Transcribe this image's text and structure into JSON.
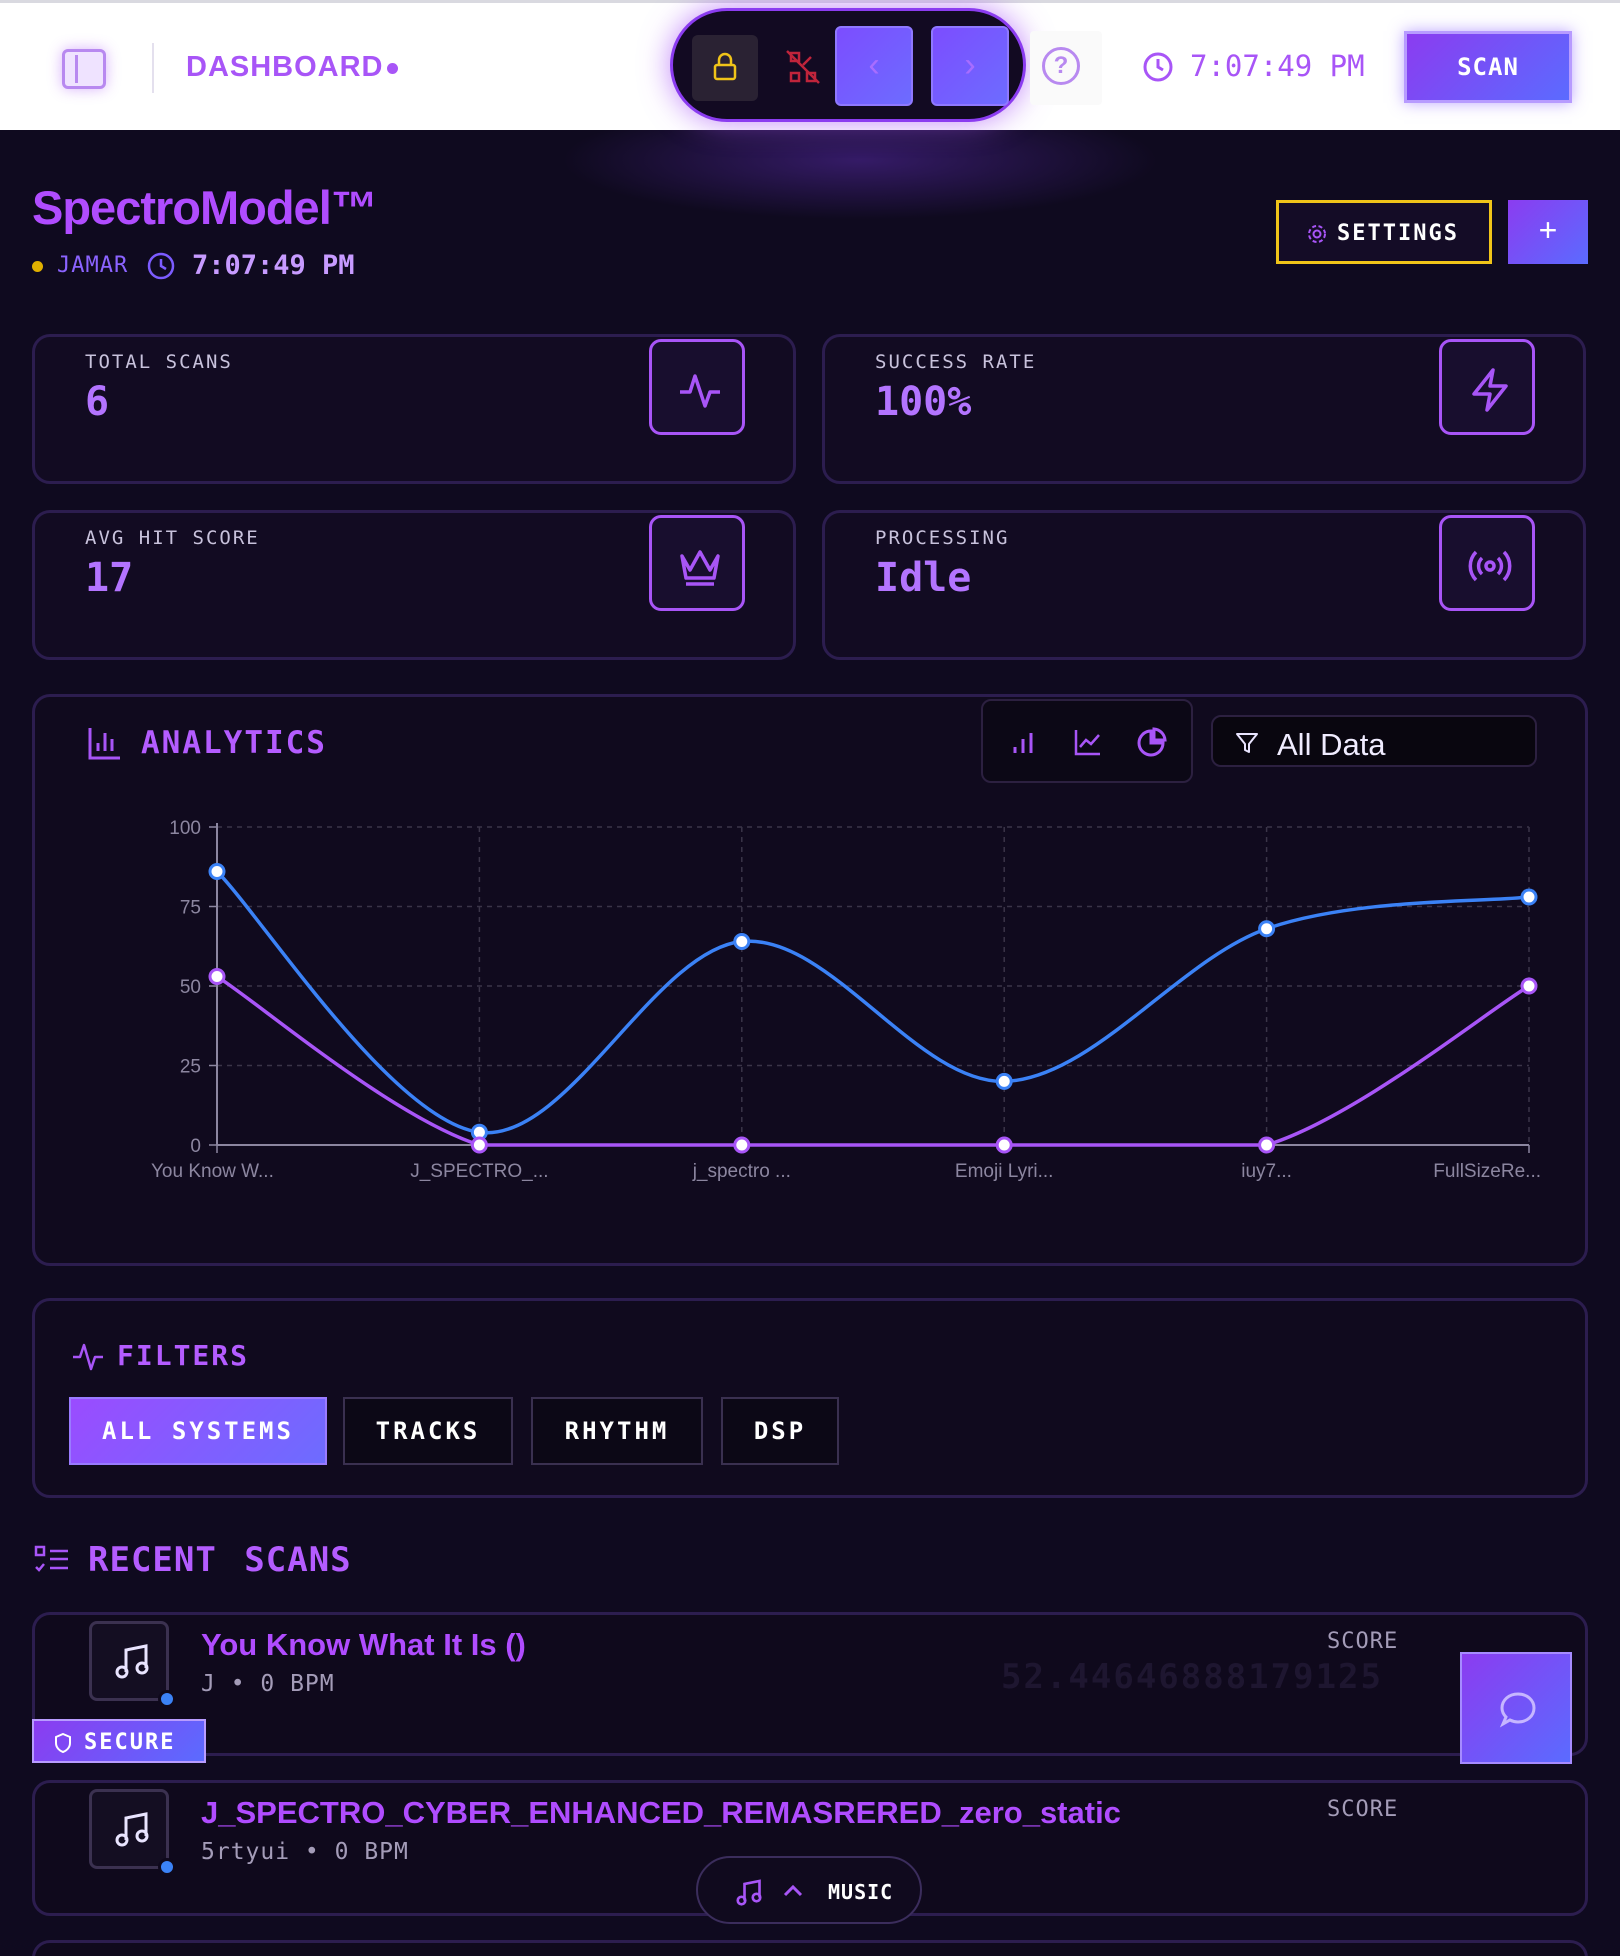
{
  "topbar": {
    "dashboard_label": "DASHBOARD",
    "time": "7:07:49 PM",
    "scan_label": "SCAN",
    "prev_glyph": "‹",
    "next_glyph": "›",
    "help_glyph": "?"
  },
  "header": {
    "app_title": "SpectroModel™",
    "user": "JAMAR",
    "time": "7:07:49 PM",
    "settings_label": "SETTINGS",
    "add_label": "+"
  },
  "stats": [
    {
      "label": "TOTAL SCANS",
      "value": "6",
      "icon": "activity-icon"
    },
    {
      "label": "SUCCESS RATE",
      "value": "100%",
      "icon": "zap-icon"
    },
    {
      "label": "AVG HIT SCORE",
      "value": "17",
      "icon": "crown-icon"
    },
    {
      "label": "PROCESSING",
      "value": "Idle",
      "icon": "radio-icon"
    }
  ],
  "analytics": {
    "title": "ANALYTICS",
    "filter_value": "All Data"
  },
  "chart_data": {
    "type": "line",
    "categories": [
      "You Know W...",
      "J_SPECTRO_...",
      "j_spectro ...",
      "Emoji Lyri...",
      "iuy7...",
      "FullSizeRe..."
    ],
    "series": [
      {
        "values": [
          86,
          4,
          64,
          20,
          68,
          78
        ],
        "color": "#3b82f6"
      },
      {
        "values": [
          53,
          0,
          0,
          0,
          0,
          50
        ],
        "color": "#a855f7"
      }
    ],
    "ylim": [
      0,
      100
    ],
    "yticks": [
      "0",
      "25",
      "50",
      "75",
      "100"
    ],
    "grid": true
  },
  "filters": {
    "title": "FILTERS",
    "buttons": [
      "ALL SYSTEMS",
      "TRACKS",
      "RHYTHM",
      "DSP"
    ]
  },
  "recent": {
    "title": "RECENT SCANS",
    "scans": [
      {
        "name": "You Know What It Is ()",
        "meta": "J • 0 BPM",
        "score_label": "SCORE",
        "score": "52.44646888179125"
      },
      {
        "name": "J_SPECTRO_CYBER_ENHANCED_REMASRERED_zero_static",
        "meta": "5rtyui • 0 BPM",
        "score_label": "SCORE"
      }
    ],
    "secure_label": "SECURE"
  },
  "music_player": {
    "label": "MUSIC"
  }
}
